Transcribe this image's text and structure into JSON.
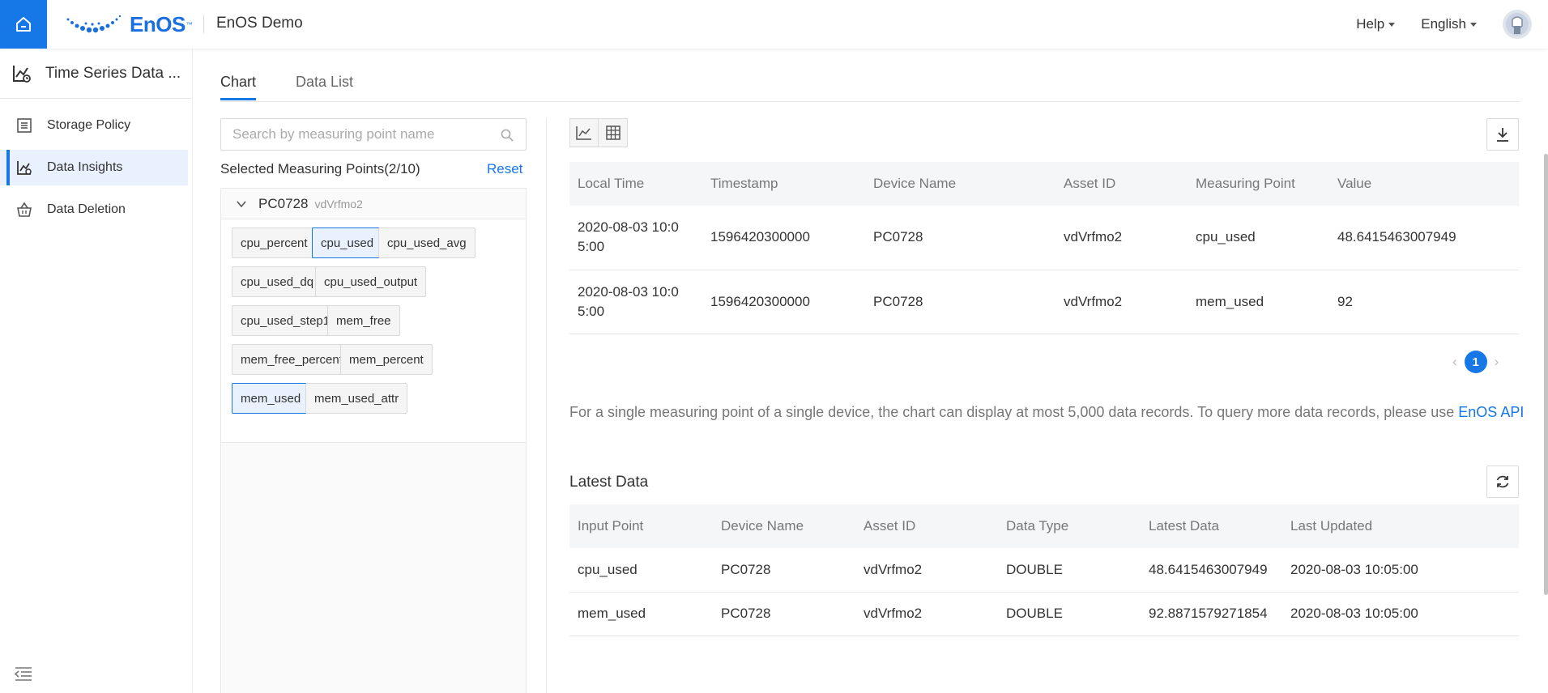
{
  "header": {
    "logo_text": "EnOS",
    "logo_tm": "™",
    "app_title": "EnOS Demo",
    "help_label": "Help",
    "language_label": "English"
  },
  "sidebar": {
    "title": "Time Series Data ...",
    "items": [
      {
        "label": "Storage Policy",
        "icon": "storage-policy-icon",
        "active": false
      },
      {
        "label": "Data Insights",
        "icon": "chart-icon",
        "active": true
      },
      {
        "label": "Data Deletion",
        "icon": "basket-icon",
        "active": false
      }
    ]
  },
  "tabs": [
    {
      "label": "Chart",
      "active": true
    },
    {
      "label": "Data List",
      "active": false
    }
  ],
  "left_panel": {
    "search_placeholder": "Search by measuring point name",
    "search_value": "",
    "selected_label": "Selected Measuring Points(2/10)",
    "reset_label": "Reset",
    "device": {
      "name": "PC0728",
      "asset_id": "vdVrfmo2"
    },
    "measuring_points": [
      {
        "label": "cpu_percent",
        "selected": false
      },
      {
        "label": "cpu_used",
        "selected": true
      },
      {
        "label": "cpu_used_avg",
        "selected": false
      },
      {
        "label": "cpu_used_dq",
        "selected": false
      },
      {
        "label": "cpu_used_output",
        "selected": false
      },
      {
        "label": "cpu_used_step1",
        "selected": false
      },
      {
        "label": "mem_free",
        "selected": false
      },
      {
        "label": "mem_free_percent",
        "selected": false
      },
      {
        "label": "mem_percent",
        "selected": false
      },
      {
        "label": "mem_used",
        "selected": true
      },
      {
        "label": "mem_used_attr",
        "selected": false
      }
    ]
  },
  "data_table": {
    "columns": [
      "Local Time",
      "Timestamp",
      "Device Name",
      "Asset ID",
      "Measuring Point",
      "Value"
    ],
    "rows": [
      [
        "2020-08-03 10:05:00",
        "1596420300000",
        "PC0728",
        "vdVrfmo2",
        "cpu_used",
        "48.6415463007949"
      ],
      [
        "2020-08-03 10:05:00",
        "1596420300000",
        "PC0728",
        "vdVrfmo2",
        "mem_used",
        "92"
      ]
    ]
  },
  "pagination": {
    "current_page": "1",
    "prev": "‹",
    "next": "›"
  },
  "note": {
    "text": "For a single measuring point of a single device, the chart can display at most 5,000 data records. To query more data records, please use ",
    "link": "EnOS API"
  },
  "latest": {
    "title": "Latest Data",
    "columns": [
      "Input Point",
      "Device Name",
      "Asset ID",
      "Data Type",
      "Latest Data",
      "Last Updated"
    ],
    "rows": [
      [
        "cpu_used",
        "PC0728",
        "vdVrfmo2",
        "DOUBLE",
        "48.6415463007949",
        "2020-08-03 10:05:00"
      ],
      [
        "mem_used",
        "PC0728",
        "vdVrfmo2",
        "DOUBLE",
        "92.8871579271854",
        "2020-08-03 10:05:00"
      ]
    ]
  },
  "colors": {
    "primary": "#1677e6",
    "active_bg": "#e8f1fd"
  }
}
